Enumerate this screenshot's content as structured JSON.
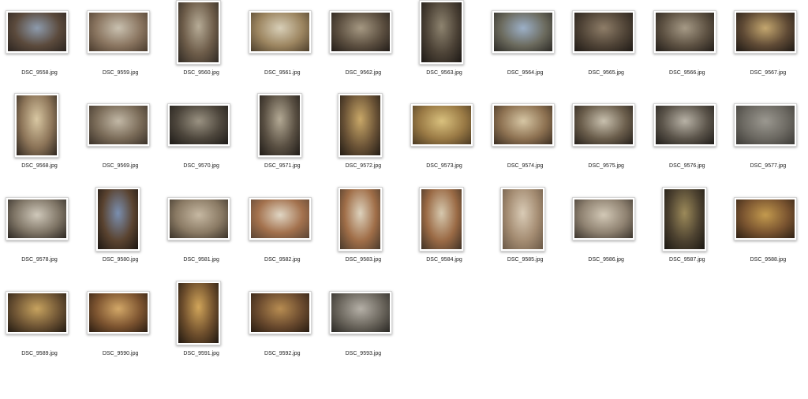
{
  "files": [
    {
      "name": "DSC_9558.jpg",
      "orientation": "landscape",
      "palette": [
        "#8d9bad",
        "#5b4a3c",
        "#2b2420"
      ]
    },
    {
      "name": "DSC_9559.jpg",
      "orientation": "landscape",
      "palette": [
        "#c9c1b0",
        "#8a7560",
        "#4a3b2d"
      ]
    },
    {
      "name": "DSC_9560.jpg",
      "orientation": "portrait",
      "palette": [
        "#b6ab96",
        "#6d5c49",
        "#2f2923"
      ]
    },
    {
      "name": "DSC_9561.jpg",
      "orientation": "landscape",
      "palette": [
        "#d8cfb8",
        "#9c8560",
        "#4d3f2c"
      ]
    },
    {
      "name": "DSC_9562.jpg",
      "orientation": "landscape",
      "palette": [
        "#a59882",
        "#5c4f40",
        "#221c18"
      ]
    },
    {
      "name": "DSC_9563.jpg",
      "orientation": "portrait",
      "palette": [
        "#8d836f",
        "#4c4236",
        "#1c1815"
      ]
    },
    {
      "name": "DSC_9564.jpg",
      "orientation": "landscape",
      "palette": [
        "#9cb0c8",
        "#6b6a5d",
        "#2c2a26"
      ]
    },
    {
      "name": "DSC_9565.jpg",
      "orientation": "landscape",
      "palette": [
        "#8e7d68",
        "#4f4336",
        "#1f1a16"
      ]
    },
    {
      "name": "DSC_9566.jpg",
      "orientation": "landscape",
      "palette": [
        "#a69a86",
        "#5d5142",
        "#221d19"
      ]
    },
    {
      "name": "DSC_9567.jpg",
      "orientation": "landscape",
      "palette": [
        "#c4a76f",
        "#5f4a35",
        "#1e1915"
      ]
    },
    {
      "name": "DSC_9568.jpg",
      "orientation": "portrait",
      "palette": [
        "#d8c7a2",
        "#8c7458",
        "#2e261f"
      ]
    },
    {
      "name": "DSC_9569.jpg",
      "orientation": "landscape",
      "palette": [
        "#c2b8a6",
        "#7a6b58",
        "#3a3128"
      ]
    },
    {
      "name": "DSC_9570.jpg",
      "orientation": "landscape",
      "palette": [
        "#9a9282",
        "#4d463c",
        "#1d1a17"
      ]
    },
    {
      "name": "DSC_9571.jpg",
      "orientation": "portrait",
      "palette": [
        "#b3a994",
        "#5a5043",
        "#1f1b17"
      ]
    },
    {
      "name": "DSC_9572.jpg",
      "orientation": "portrait",
      "palette": [
        "#c9a868",
        "#6c5437",
        "#231c15"
      ]
    },
    {
      "name": "DSC_9573.jpg",
      "orientation": "landscape",
      "palette": [
        "#d9c17e",
        "#9a7a45",
        "#4b3a23"
      ]
    },
    {
      "name": "DSC_9574.jpg",
      "orientation": "landscape",
      "palette": [
        "#d6c6a4",
        "#8e7252",
        "#3b2e22"
      ]
    },
    {
      "name": "DSC_9575.jpg",
      "orientation": "landscape",
      "palette": [
        "#c8c0ae",
        "#6b5e4c",
        "#26201b"
      ]
    },
    {
      "name": "DSC_9576.jpg",
      "orientation": "landscape",
      "palette": [
        "#b8b2a6",
        "#5c554b",
        "#1f1c19"
      ]
    },
    {
      "name": "DSC_9577.jpg",
      "orientation": "landscape",
      "palette": [
        "#9b9890",
        "#6c6962",
        "#3c3a36"
      ]
    },
    {
      "name": "DSC_9578.jpg",
      "orientation": "landscape",
      "palette": [
        "#cfc8ba",
        "#7f7566",
        "#2c2722"
      ]
    },
    {
      "name": "DSC_9580.jpg",
      "orientation": "portrait",
      "palette": [
        "#7a8fb0",
        "#5a4330",
        "#1c1612"
      ]
    },
    {
      "name": "DSC_9581.jpg",
      "orientation": "landscape",
      "palette": [
        "#c6b8a2",
        "#8a7a64",
        "#3a3228"
      ]
    },
    {
      "name": "DSC_9582.jpg",
      "orientation": "landscape",
      "palette": [
        "#e0d6c4",
        "#a3714d",
        "#5a4434"
      ]
    },
    {
      "name": "DSC_9583.jpg",
      "orientation": "portrait",
      "palette": [
        "#ddd2bd",
        "#a06e48",
        "#4a3a2c"
      ]
    },
    {
      "name": "DSC_9584.jpg",
      "orientation": "portrait",
      "palette": [
        "#d6c8ae",
        "#9a6a45",
        "#3f3226"
      ]
    },
    {
      "name": "DSC_9585.jpg",
      "orientation": "portrait",
      "palette": [
        "#d9cbb6",
        "#a48c72",
        "#6a5846"
      ]
    },
    {
      "name": "DSC_9586.jpg",
      "orientation": "landscape",
      "palette": [
        "#d2c8b6",
        "#8f8271",
        "#3c352d"
      ]
    },
    {
      "name": "DSC_9587.jpg",
      "orientation": "portrait",
      "palette": [
        "#9c8a5a",
        "#4d4230",
        "#1a1712"
      ]
    },
    {
      "name": "DSC_9588.jpg",
      "orientation": "landscape",
      "palette": [
        "#c39a4e",
        "#7a5430",
        "#2e2014"
      ]
    },
    {
      "name": "DSC_9589.jpg",
      "orientation": "landscape",
      "palette": [
        "#c7a35f",
        "#6e5434",
        "#221a12"
      ]
    },
    {
      "name": "DSC_9590.jpg",
      "orientation": "landscape",
      "palette": [
        "#d3a868",
        "#7d5430",
        "#2b1d12"
      ]
    },
    {
      "name": "DSC_9591.jpg",
      "orientation": "portrait",
      "palette": [
        "#d1a55a",
        "#6e4e2c",
        "#1f1710"
      ]
    },
    {
      "name": "DSC_9592.jpg",
      "orientation": "landscape",
      "palette": [
        "#b88d52",
        "#6a4a2e",
        "#281c12"
      ]
    },
    {
      "name": "DSC_9593.jpg",
      "orientation": "landscape",
      "palette": [
        "#b5b0a7",
        "#6a655c",
        "#2a2824"
      ]
    }
  ]
}
